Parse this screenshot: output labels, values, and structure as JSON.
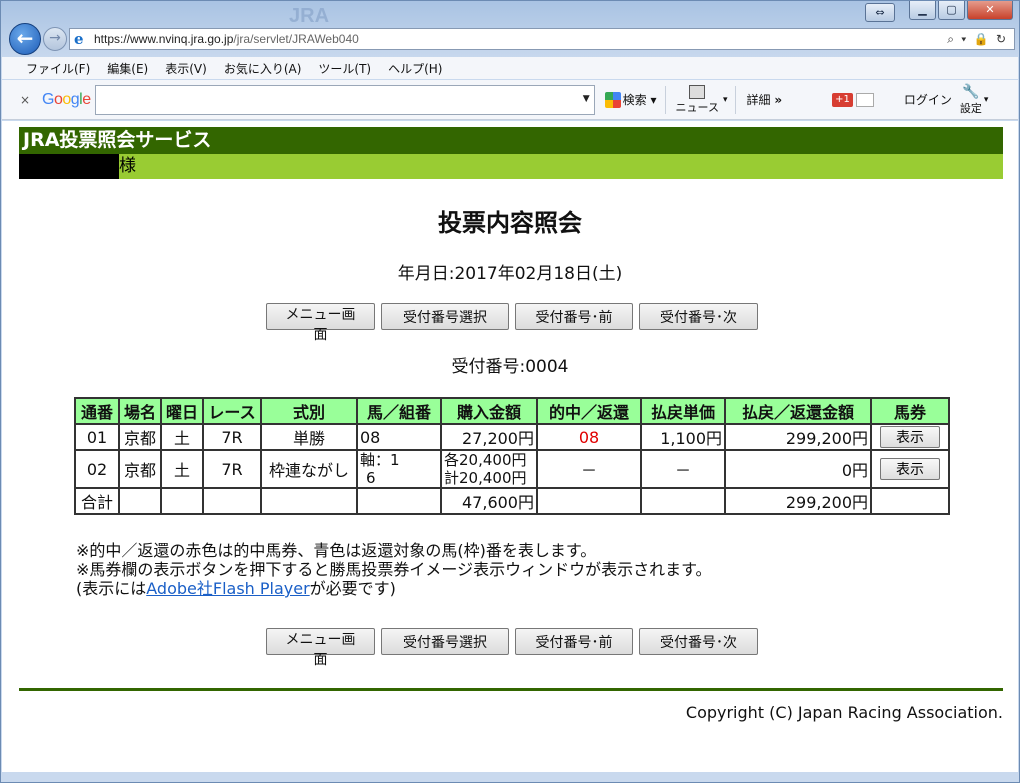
{
  "browser": {
    "url_host": "https://www.nvinq.jra.go.jp",
    "url_path": "/jra/servlet/JRAWeb040",
    "addr_tools": "⌕ ▾ 🔒 ↻",
    "watermark": "JRA",
    "menu": [
      "ファイル(F)",
      "編集(E)",
      "表示(V)",
      "お気に入り(A)",
      "ツール(T)",
      "ヘルプ(H)"
    ],
    "google": {
      "close": "×",
      "logo": "Google",
      "search_label": "検索",
      "news_label": "ニュース",
      "details_label": "詳細",
      "gplus_label": "+1",
      "login_label": "ログイン",
      "settings_label": "設定"
    }
  },
  "page": {
    "service_name": "JRA投票照会サービス",
    "user_suffix": "様",
    "title": "投票内容照会",
    "date_line": "年月日:2017年02月18日(土)",
    "buttons": {
      "menu": "メニュー画面",
      "select": "受付番号選択",
      "prev": "受付番号･前",
      "next": "受付番号･次"
    },
    "receipt_line": "受付番号:0004",
    "table": {
      "headers": [
        "通番",
        "場名",
        "曜日",
        "レース",
        "式別",
        "馬／組番",
        "購入金額",
        "的中／返還",
        "払戻単価",
        "払戻／返還金額",
        "馬券"
      ],
      "rows": [
        {
          "no": "01",
          "venue": "京都",
          "day": "土",
          "race": "7R",
          "type": "単勝",
          "combo": "08",
          "amount": "27,200円",
          "hit": "08",
          "unit": "1,100円",
          "payout": "299,200円",
          "show": "表示"
        },
        {
          "no": "02",
          "venue": "京都",
          "day": "土",
          "race": "7R",
          "type": "枠連ながし",
          "combo_line1": "軸：1",
          "combo_line2": "6",
          "amount_line1": "各20,400円",
          "amount_line2": "計20,400円",
          "hit": "－",
          "unit": "－",
          "payout": "0円",
          "show": "表示"
        }
      ],
      "total": {
        "label": "合計",
        "amount": "47,600円",
        "payout": "299,200円"
      }
    },
    "notes": {
      "line1": "※的中／返還の赤色は的中馬券、青色は返還対象の馬(枠)番を表します。",
      "line2": "※馬券欄の表示ボタンを押下すると勝馬投票券イメージ表示ウィンドウが表示されます。",
      "line3_pre": "(表示には",
      "line3_link": "Adobe社Flash Player",
      "line3_post": "が必要です)"
    },
    "copyright": "Copyright (C) Japan Racing Association."
  }
}
